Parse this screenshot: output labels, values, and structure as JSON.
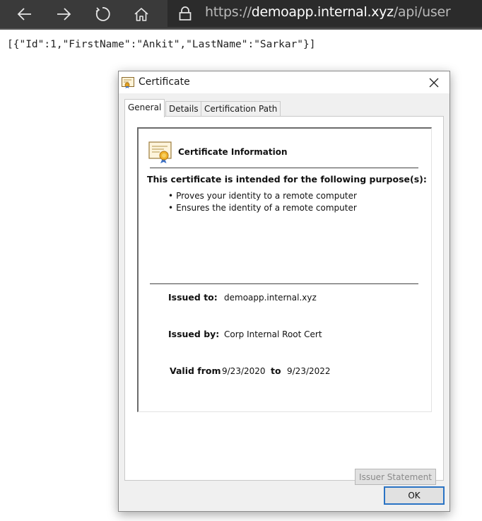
{
  "browser": {
    "url": {
      "scheme": "https://",
      "host": "demoapp.internal.xyz",
      "path": "/api/user"
    },
    "icons": {
      "back": "back-arrow-icon",
      "forward": "forward-arrow-icon",
      "refresh": "refresh-icon",
      "home": "home-icon",
      "lock": "lock-icon"
    }
  },
  "page": {
    "json_text": "[{\"Id\":1,\"FirstName\":\"Ankit\",\"LastName\":\"Sarkar\"}]"
  },
  "dialog": {
    "title": "Certificate",
    "tabs": [
      {
        "label": "General",
        "active": true
      },
      {
        "label": "Details",
        "active": false
      },
      {
        "label": "Certification Path",
        "active": false
      }
    ],
    "info_heading": "Certificate Information",
    "purpose_heading": "This certificate is intended for the following purpose(s):",
    "purposes": [
      "Proves your identity to a remote computer",
      "Ensures the identity of a remote computer"
    ],
    "bullet": "•",
    "issued_to_label": "Issued to:",
    "issued_to_value": "demoapp.internal.xyz",
    "issued_by_label": "Issued by:",
    "issued_by_value": "Corp Internal Root Cert",
    "valid_from_label": "Valid from",
    "valid_from_value": "9/23/2020",
    "valid_to_label": "to",
    "valid_to_value": "9/23/2022",
    "issuer_statement_label": "Issuer Statement",
    "ok_label": "OK"
  },
  "colors": {
    "toolbar": "#3a3a3a",
    "address_bar": "#2b2b2b",
    "dialog_bg": "#f0f0f0",
    "ok_border": "#2a73c4"
  }
}
